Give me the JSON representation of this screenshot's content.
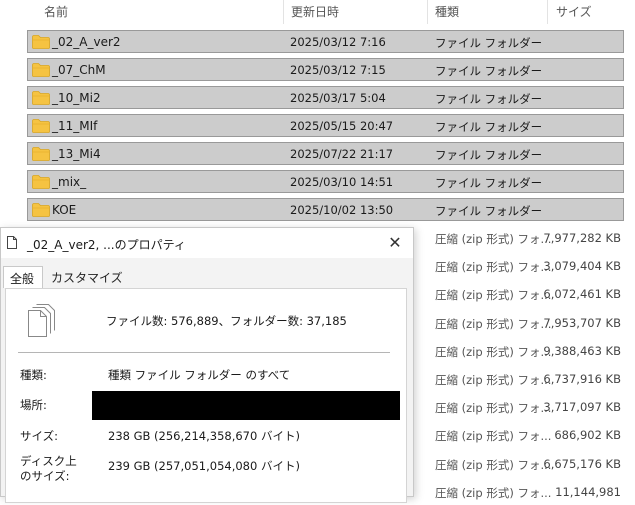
{
  "explorer": {
    "columns": {
      "name": "名前",
      "modified": "更新日時",
      "type": "種類",
      "size": "サイズ"
    },
    "folders": [
      {
        "name": "_02_A_ver2",
        "modified": "2025/03/12 7:16",
        "type": "ファイル フォルダー"
      },
      {
        "name": "_07_ChM",
        "modified": "2025/03/12 7:15",
        "type": "ファイル フォルダー"
      },
      {
        "name": "_10_Mi2",
        "modified": "2025/03/17 5:04",
        "type": "ファイル フォルダー"
      },
      {
        "name": "_11_MIf",
        "modified": "2025/05/15 20:47",
        "type": "ファイル フォルダー"
      },
      {
        "name": "_13_Mi4",
        "modified": "2025/07/22 21:17",
        "type": "ファイル フォルダー"
      },
      {
        "name": "_mix_",
        "modified": "2025/03/10 14:51",
        "type": "ファイル フォルダー"
      },
      {
        "name": "KOE",
        "modified": "2025/10/02 13:50",
        "type": "ファイル フォルダー"
      }
    ],
    "zips": [
      {
        "type": "圧縮 (zip 形式) フォ...",
        "size": "7,977,282 KB"
      },
      {
        "type": "圧縮 (zip 形式) フォ...",
        "size": "3,079,404 KB"
      },
      {
        "type": "圧縮 (zip 形式) フォ...",
        "size": "6,072,461 KB"
      },
      {
        "type": "圧縮 (zip 形式) フォ...",
        "size": "7,953,707 KB"
      },
      {
        "type": "圧縮 (zip 形式) フォ...",
        "size": "9,388,463 KB"
      },
      {
        "type": "圧縮 (zip 形式) フォ...",
        "size": "6,737,916 KB"
      },
      {
        "type": "圧縮 (zip 形式) フォ...",
        "size": "3,717,097 KB"
      },
      {
        "type": "圧縮 (zip 形式) フォ...",
        "size": "686,902 KB"
      },
      {
        "type": "圧縮 (zip 形式) フォ...",
        "size": "6,675,176 KB"
      },
      {
        "type": "圧縮 (zip 形式) フォ...",
        "size": "11,144,981"
      }
    ]
  },
  "dialog": {
    "title": "_02_A_ver2, ...のプロパティ",
    "close": "✕",
    "tabs": [
      "全般",
      "カスタマイズ"
    ],
    "summary": "ファイル数: 576,889、フォルダー数: 37,185",
    "type_label": "種類:",
    "type_value": "種類 ファイル フォルダー のすべて",
    "location_label": "場所:",
    "size_label": "サイズ:",
    "size_value": "238 GB (256,214,358,670 バイト)",
    "disk_label_1": "ディスク上",
    "disk_label_2": "のサイズ:",
    "disk_value": "239 GB (257,051,054,080 バイト)"
  },
  "icons": [
    "folder-icon",
    "document-icon",
    "multi-document-icon",
    "close-icon",
    "sort-caret-icon"
  ],
  "colors": {
    "selected_row": "#cccccc",
    "folder": "#f5c342",
    "dialog_bg": "#f3f3f3"
  }
}
